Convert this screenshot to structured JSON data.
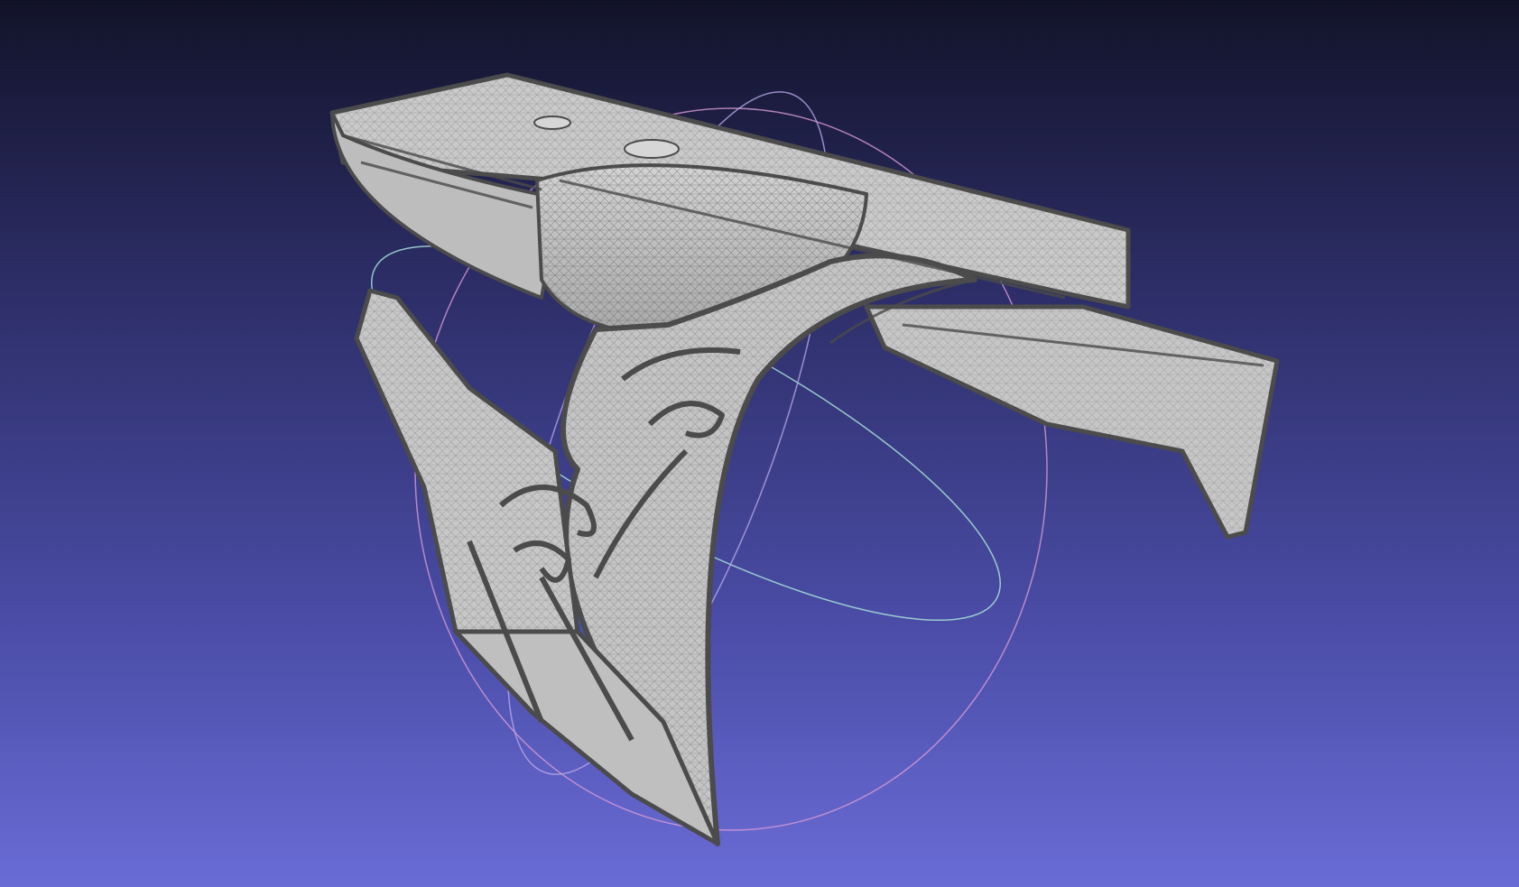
{
  "viewer": {
    "background_top": "#121329",
    "background_bottom": "#6a6cd6",
    "mesh_fill": "#c9c9c9",
    "mesh_edge": "#4b4b4b",
    "wire_color": "#5a5a5a",
    "trackball_colors": [
      "#d59ad6",
      "#a8e0d8",
      "#b7a8e6"
    ]
  }
}
